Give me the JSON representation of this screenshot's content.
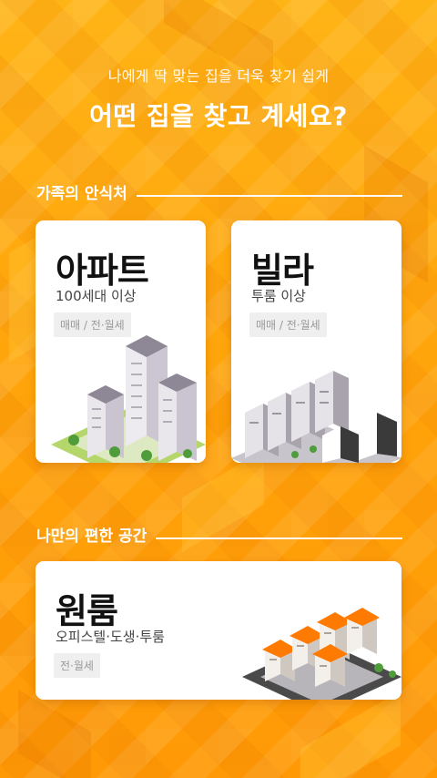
{
  "header": {
    "subtitle": "나에게 딱 맞는 집을 더욱 찾기 쉽게",
    "title": "어떤 집을 찾고 계세요?"
  },
  "sections": [
    {
      "label": "가족의 안식처",
      "cards": [
        {
          "name": "아파트",
          "desc": "100세대 이상",
          "tag": "매매 / 전·월세",
          "icon": "apartment-illustration"
        },
        {
          "name": "빌라",
          "desc": "투룸 이상",
          "tag": "매매 / 전·월세",
          "icon": "villa-illustration"
        }
      ]
    },
    {
      "label": "나만의 편한 공간",
      "cards": [
        {
          "name": "원룸",
          "desc": "오피스텔·도생·투룸",
          "tag": "전·월세",
          "icon": "oneroom-illustration"
        }
      ]
    }
  ],
  "colors": {
    "background": "#FFA60A",
    "card": "#FFFFFF",
    "roof": "#FF8A00"
  }
}
